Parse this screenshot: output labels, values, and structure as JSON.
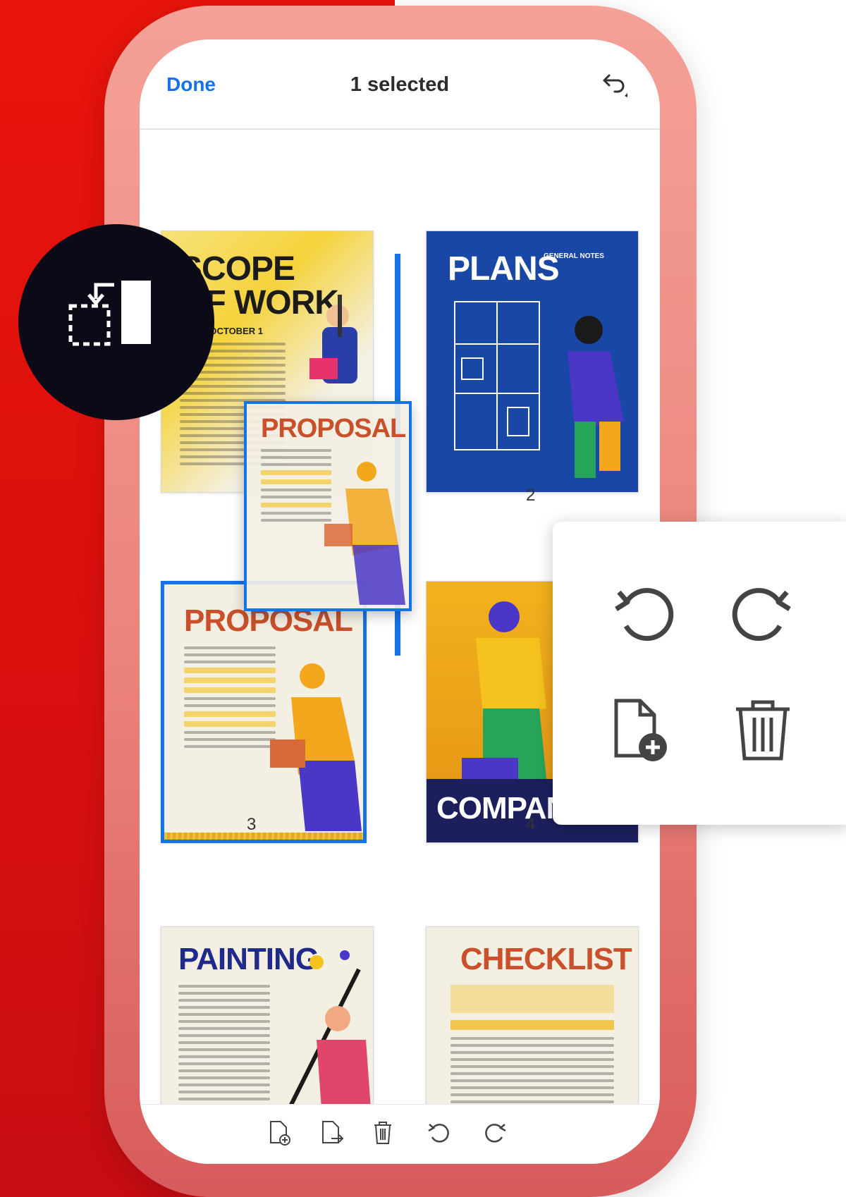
{
  "header": {
    "done_label": "Done",
    "title": "1 selected"
  },
  "pages": [
    {
      "title_line1": "SCOPE",
      "title_line2": "OF WORK",
      "subtitle": "DATE: OCTOBER 1"
    },
    {
      "title": "PLANS",
      "subtitle": "GENERAL NOTES",
      "number": "2"
    },
    {
      "title": "PROPOSAL",
      "number": "3"
    },
    {
      "title": "COMPANY",
      "number": "4"
    },
    {
      "title": "PAINTING"
    },
    {
      "title": "CHECKLIST"
    }
  ],
  "dragging_page": {
    "title": "PROPOSAL"
  },
  "colors": {
    "brand_red": "#e8140a",
    "accent_blue": "#1473e6",
    "dark": "#0b0b17"
  },
  "icons": {
    "badge": "reorder-pages-icon",
    "popup": [
      "rotate-left-icon",
      "rotate-right-icon",
      "insert-page-icon",
      "delete-icon"
    ],
    "bottombar": [
      "insert-page-icon",
      "extract-page-icon",
      "delete-icon",
      "rotate-left-icon",
      "rotate-right-icon"
    ]
  }
}
